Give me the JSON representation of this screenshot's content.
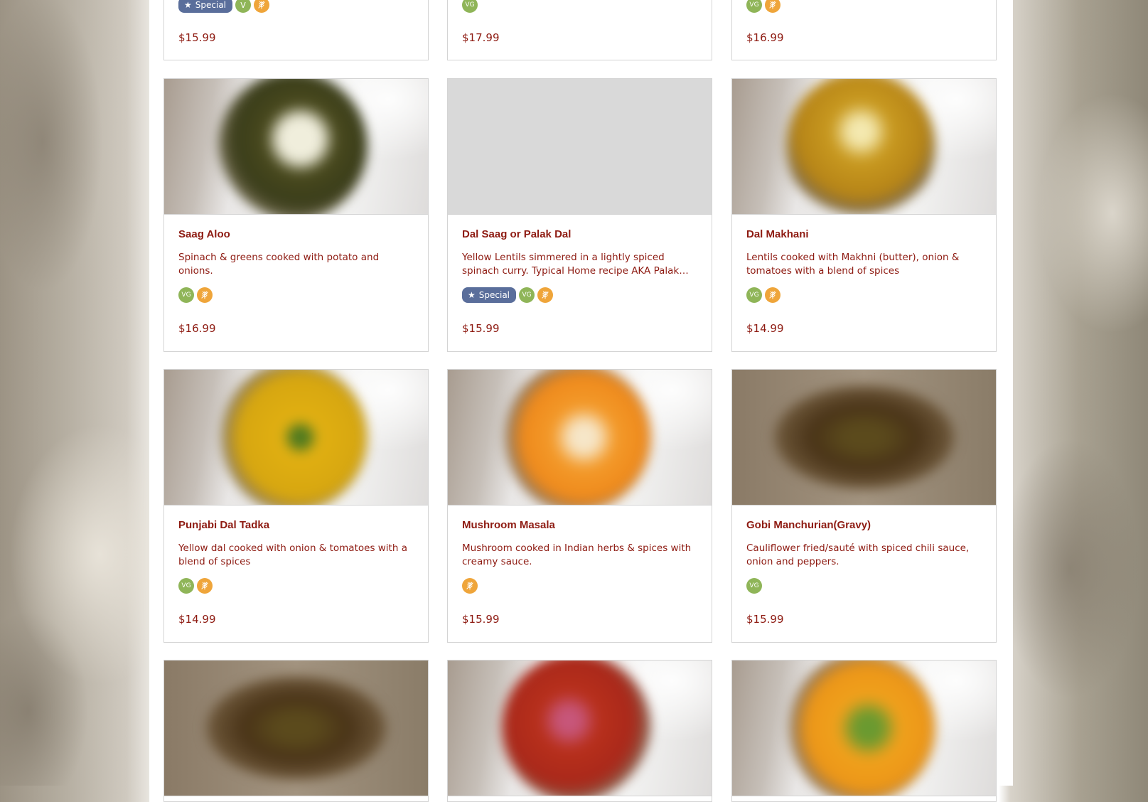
{
  "top_row": [
    {
      "price": "$15.99",
      "special_label": "Special"
    },
    {
      "price": "$17.99"
    },
    {
      "price": "$16.99"
    }
  ],
  "badge_labels": {
    "vg": "VG",
    "v": "V"
  },
  "items": [
    {
      "title": "Saag Aloo",
      "desc": "Spinach & greens cooked with potato and onions.",
      "price": "$16.99"
    },
    {
      "title": "Dal Saag or Palak Dal",
      "desc": "Yellow Lentils simmered in a lightly spiced spinach curry. Typical Home recipe AKA Palak Dal.",
      "price": "$15.99",
      "special_label": "Special"
    },
    {
      "title": "Dal Makhani",
      "desc": "Lentils cooked with Makhni (butter), onion & tomatoes with a blend of spices",
      "price": "$14.99"
    },
    {
      "title": "Punjabi Dal Tadka",
      "desc": "Yellow dal cooked with onion & tomatoes with a blend of spices",
      "price": "$14.99"
    },
    {
      "title": "Mushroom Masala",
      "desc": "Mushroom cooked in Indian herbs & spices with creamy sauce.",
      "price": "$15.99"
    },
    {
      "title": "Gobi Manchurian(Gravy)",
      "desc": "Cauliflower fried/sauté with spiced chili sauce, onion and peppers.",
      "price": "$15.99"
    }
  ],
  "colors": {
    "accent": "#8e1b12",
    "special": "#5a6e9b",
    "vegan": "#8fb558",
    "gluten_free": "#efa53a"
  }
}
